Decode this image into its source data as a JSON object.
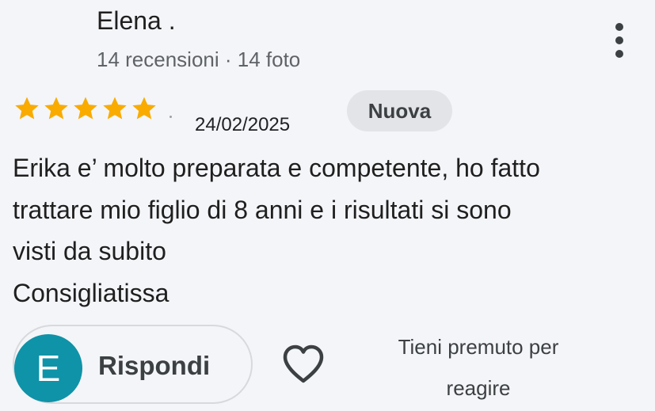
{
  "review": {
    "author": {
      "name": "Elena .",
      "meta": "14 recensioni · 14 foto",
      "avatar_initial": "E",
      "avatar_color": "#0f93a8"
    },
    "rating": 5,
    "rating_max": 5,
    "star_color": "#f9ab00",
    "date": "24/02/2025",
    "badge": "Nuova",
    "text_lines": [
      "Erika e’ molto preparata e competente, ho fatto",
      "trattare mio figlio di 8 anni e i risultati si sono",
      "visti da subito",
      "Consigliatissa"
    ]
  },
  "actions": {
    "reply_label": "Rispondi",
    "react_hint_line1": "Tieni premuto per",
    "react_hint_line2": "reagire"
  },
  "icons": {
    "menu": "more-vert-icon",
    "like": "heart-outline-icon",
    "star": "star-icon"
  }
}
